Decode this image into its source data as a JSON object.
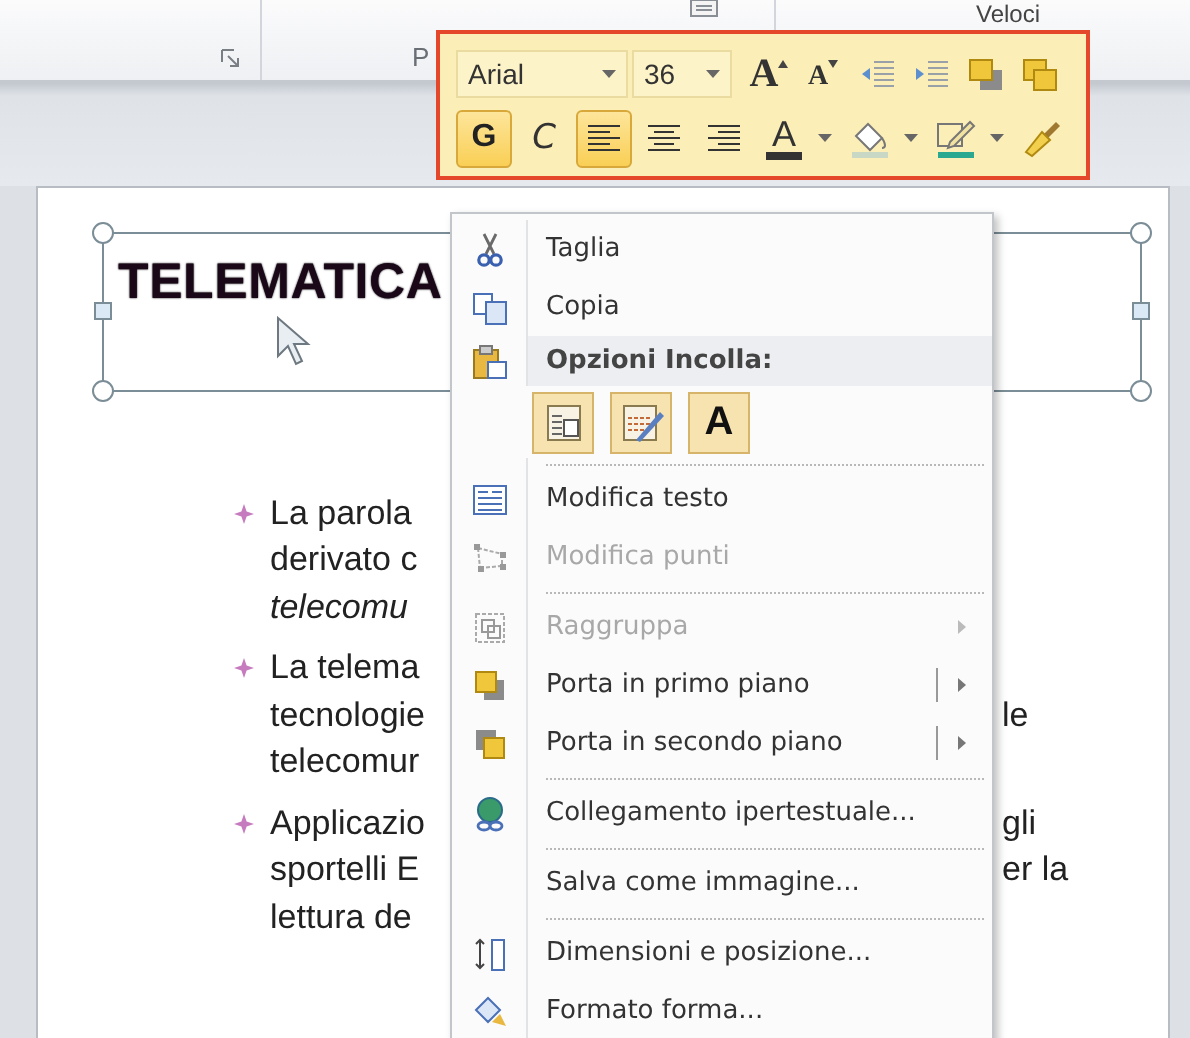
{
  "ribbon": {
    "group_label": "P",
    "top_right_label": "Veloci"
  },
  "mini_toolbar": {
    "font": "Arial",
    "size": "36",
    "row1": [
      {
        "kind": "grow",
        "label": "A"
      },
      {
        "kind": "shrink",
        "label": "A"
      },
      {
        "kind": "outdent"
      },
      {
        "kind": "indent"
      },
      {
        "kind": "forward"
      },
      {
        "kind": "backward"
      }
    ],
    "row2": [
      {
        "kind": "bold",
        "label": "G",
        "selected": true
      },
      {
        "kind": "italic",
        "label": "C",
        "selected": false
      },
      {
        "kind": "align-left",
        "selected": true
      },
      {
        "kind": "align-center",
        "selected": false
      },
      {
        "kind": "align-right",
        "selected": false
      },
      {
        "kind": "font-color",
        "label": "A"
      },
      {
        "kind": "fill"
      },
      {
        "kind": "outline"
      },
      {
        "kind": "painter"
      }
    ]
  },
  "slide": {
    "title": "TELEMATICA",
    "lines": [
      {
        "text": "La parola",
        "bullet": true,
        "italic": false
      },
      {
        "text": "derivato c",
        "bullet": false,
        "italic": false
      },
      {
        "text": "telecomu",
        "bullet": false,
        "italic": true
      },
      {
        "text": "La telema",
        "bullet": true,
        "italic": false
      },
      {
        "text": "tecnologie",
        "bullet": false,
        "italic": false,
        "right": "le"
      },
      {
        "text": "telecomur",
        "bullet": false,
        "italic": false
      },
      {
        "text": "Applicazio",
        "bullet": true,
        "italic": false,
        "right": "gli"
      },
      {
        "text": "sportelli E",
        "bullet": false,
        "italic": false,
        "right": "er la"
      },
      {
        "text": "lettura de",
        "bullet": false,
        "italic": false
      }
    ]
  },
  "menu": {
    "items": [
      {
        "kind": "item",
        "label": "Taglia",
        "disabled": false,
        "submenu": false,
        "split": false
      },
      {
        "kind": "item",
        "label": "Copia",
        "disabled": false,
        "submenu": false,
        "split": false
      },
      {
        "kind": "header",
        "label": "Opzioni Incolla:"
      },
      {
        "kind": "paste",
        "options": [
          {
            "kind": "keep-format"
          },
          {
            "kind": "merge"
          },
          {
            "kind": "text-only",
            "label": "A"
          }
        ]
      },
      {
        "kind": "separator"
      },
      {
        "kind": "item",
        "label": "Modifica testo",
        "disabled": false,
        "submenu": false,
        "split": false
      },
      {
        "kind": "item",
        "label": "Modifica punti",
        "disabled": true,
        "submenu": false,
        "split": false
      },
      {
        "kind": "separator"
      },
      {
        "kind": "item",
        "label": "Raggruppa",
        "disabled": true,
        "submenu": true,
        "split": false
      },
      {
        "kind": "item",
        "label": "Porta in primo piano",
        "disabled": false,
        "submenu": true,
        "split": true
      },
      {
        "kind": "item",
        "label": "Porta in secondo piano",
        "disabled": false,
        "submenu": true,
        "split": true
      },
      {
        "kind": "separator"
      },
      {
        "kind": "item",
        "label": "Collegamento ipertestuale...",
        "disabled": false,
        "submenu": false,
        "split": false
      },
      {
        "kind": "separator"
      },
      {
        "kind": "item",
        "label": "Salva come immagine...",
        "disabled": false,
        "submenu": false,
        "split": false
      },
      {
        "kind": "separator"
      },
      {
        "kind": "item",
        "label": "Dimensioni e posizione...",
        "disabled": false,
        "submenu": false,
        "split": false
      },
      {
        "kind": "item",
        "label": "Formato forma...",
        "disabled": false,
        "submenu": false,
        "split": false
      }
    ]
  }
}
